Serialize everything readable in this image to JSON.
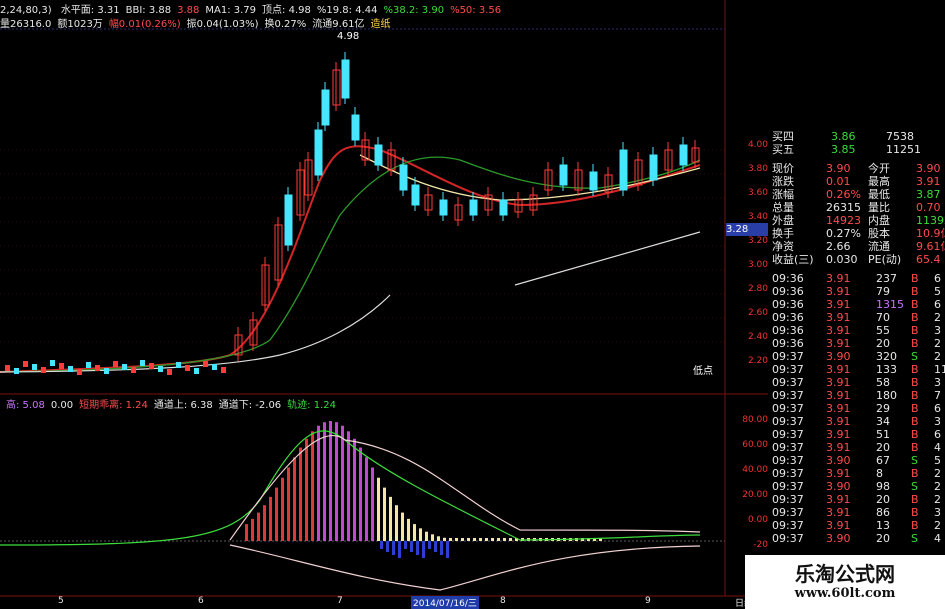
{
  "top_bar": {
    "items": [
      {
        "text": "水平面: 3.31",
        "color": "#e8e8e8"
      },
      {
        "text": "BBI: 3.88",
        "color": "#e8e8e8"
      },
      {
        "text": "3.88",
        "color": "#ff4b4b"
      },
      {
        "text": "MA1: 3.79",
        "color": "#e8e8e8"
      },
      {
        "text": "顶点: 4.98",
        "color": "#e8e8e8"
      },
      {
        "text": "%19.8: 4.44",
        "color": "#e8e8e8"
      },
      {
        "text": "%38.2: 3.90",
        "color": "#3cdc3c"
      },
      {
        "text": "%50: 3.56",
        "color": "#ff4b4b"
      }
    ],
    "left_fragment": "2,24,80,3)"
  },
  "info_bar": {
    "items": [
      {
        "text": "量26316.0",
        "color": "#e8e8e8"
      },
      {
        "text": "额1023万",
        "color": "#e8e8e8"
      },
      {
        "text": "幅0.01(0.26%)",
        "color": "#ff4b4b"
      },
      {
        "text": "振0.04(1.03%)",
        "color": "#e8e8e8"
      },
      {
        "text": "换0.27%",
        "color": "#e8e8e8"
      },
      {
        "text": "流通9.61亿",
        "color": "#e8e8e8"
      },
      {
        "text": "造纸",
        "color": "#ffd34a"
      }
    ]
  },
  "main_chart": {
    "peak_label": "4.98",
    "low_label": "低点",
    "current_price_tag": "3.28",
    "y_ticks": [
      "4.00",
      "3.80",
      "3.60",
      "3.40",
      "3.20",
      "3.00",
      "2.80",
      "2.60",
      "2.40",
      "2.20"
    ]
  },
  "indicator_bar": {
    "items": [
      {
        "text": "高: 5.08",
        "color": "#c873ff"
      },
      {
        "text": "0.00",
        "color": "#e8e8e8"
      },
      {
        "text": "短期乖离: 1.24",
        "color": "#ff4b4b"
      },
      {
        "text": "通道上: 6.38",
        "color": "#e8e8e8"
      },
      {
        "text": "通道下: -2.06",
        "color": "#e8e8e8"
      },
      {
        "text": "轨迹: 1.24",
        "color": "#3cdc3c"
      }
    ],
    "y_ticks": [
      "80.00",
      "60.00",
      "40.00",
      "20.00",
      "0.00",
      "-20"
    ]
  },
  "x_axis": {
    "labels": [
      "5",
      "6",
      "7",
      "8",
      "9"
    ],
    "date_highlight": "2014/07/16/三",
    "period": "日线"
  },
  "quote_panel": {
    "asks": [
      {
        "label": "买四",
        "price": "3.86",
        "vol": "7538"
      },
      {
        "label": "买五",
        "price": "3.85",
        "vol": "11251"
      }
    ],
    "stats": [
      {
        "k1": "现价",
        "v1": "3.90",
        "k2": "今开",
        "v2": "3.90"
      },
      {
        "k1": "涨跌",
        "v1": "0.01",
        "k2": "最高",
        "v2": "3.91"
      },
      {
        "k1": "涨幅",
        "v1": "0.26%",
        "k2": "最低",
        "v2": "3.87"
      },
      {
        "k1": "总量",
        "v1": "26315",
        "k2": "量比",
        "v2": "0.70"
      },
      {
        "k1": "外盘",
        "v1": "14923",
        "k2": "内盘",
        "v2": "11392"
      },
      {
        "k1": "换手",
        "v1": "0.27%",
        "k2": "股本",
        "v2": "10.9亿"
      },
      {
        "k1": "净资",
        "v1": "2.66",
        "k2": "流通",
        "v2": "9.61亿"
      },
      {
        "k1": "收益(三)",
        "v1": "0.030",
        "k2": "PE(动)",
        "v2": "65.4"
      }
    ],
    "ticks": [
      {
        "t": "09:36",
        "p": "3.91",
        "v": "237",
        "s": "B",
        "n": "6"
      },
      {
        "t": "09:36",
        "p": "3.91",
        "v": "79",
        "s": "B",
        "n": "5"
      },
      {
        "t": "09:36",
        "p": "3.91",
        "v": "1315",
        "s": "B",
        "n": "6"
      },
      {
        "t": "09:36",
        "p": "3.91",
        "v": "70",
        "s": "B",
        "n": "2"
      },
      {
        "t": "09:36",
        "p": "3.91",
        "v": "55",
        "s": "B",
        "n": "3"
      },
      {
        "t": "09:36",
        "p": "3.91",
        "v": "20",
        "s": "B",
        "n": "2"
      },
      {
        "t": "09:37",
        "p": "3.90",
        "v": "320",
        "s": "S",
        "n": "2"
      },
      {
        "t": "09:37",
        "p": "3.91",
        "v": "133",
        "s": "B",
        "n": "11"
      },
      {
        "t": "09:37",
        "p": "3.91",
        "v": "58",
        "s": "B",
        "n": "3"
      },
      {
        "t": "09:37",
        "p": "3.91",
        "v": "180",
        "s": "B",
        "n": "7"
      },
      {
        "t": "09:37",
        "p": "3.91",
        "v": "29",
        "s": "B",
        "n": "6"
      },
      {
        "t": "09:37",
        "p": "3.91",
        "v": "34",
        "s": "B",
        "n": "3"
      },
      {
        "t": "09:37",
        "p": "3.91",
        "v": "51",
        "s": "B",
        "n": "6"
      },
      {
        "t": "09:37",
        "p": "3.91",
        "v": "20",
        "s": "B",
        "n": "4"
      },
      {
        "t": "09:37",
        "p": "3.90",
        "v": "67",
        "s": "S",
        "n": "5"
      },
      {
        "t": "09:37",
        "p": "3.91",
        "v": "8",
        "s": "B",
        "n": "2"
      },
      {
        "t": "09:37",
        "p": "3.90",
        "v": "98",
        "s": "S",
        "n": "2"
      },
      {
        "t": "09:37",
        "p": "3.91",
        "v": "20",
        "s": "B",
        "n": "2"
      },
      {
        "t": "09:37",
        "p": "3.91",
        "v": "86",
        "s": "B",
        "n": "3"
      },
      {
        "t": "09:37",
        "p": "3.91",
        "v": "13",
        "s": "B",
        "n": "2"
      },
      {
        "t": "09:37",
        "p": "3.90",
        "v": "20",
        "s": "S",
        "n": "4"
      }
    ]
  },
  "watermark": {
    "title": "乐淘公式网",
    "url": "www.60lt.com"
  },
  "colors": {
    "up": "#ff3b3b",
    "down": "#46e6ff",
    "ma_red": "#d22626",
    "ma_green": "#2a9a2a",
    "ma_white": "#dddddd",
    "ma_yellow": "#f3e7a8",
    "grid": "#7a1010"
  }
}
